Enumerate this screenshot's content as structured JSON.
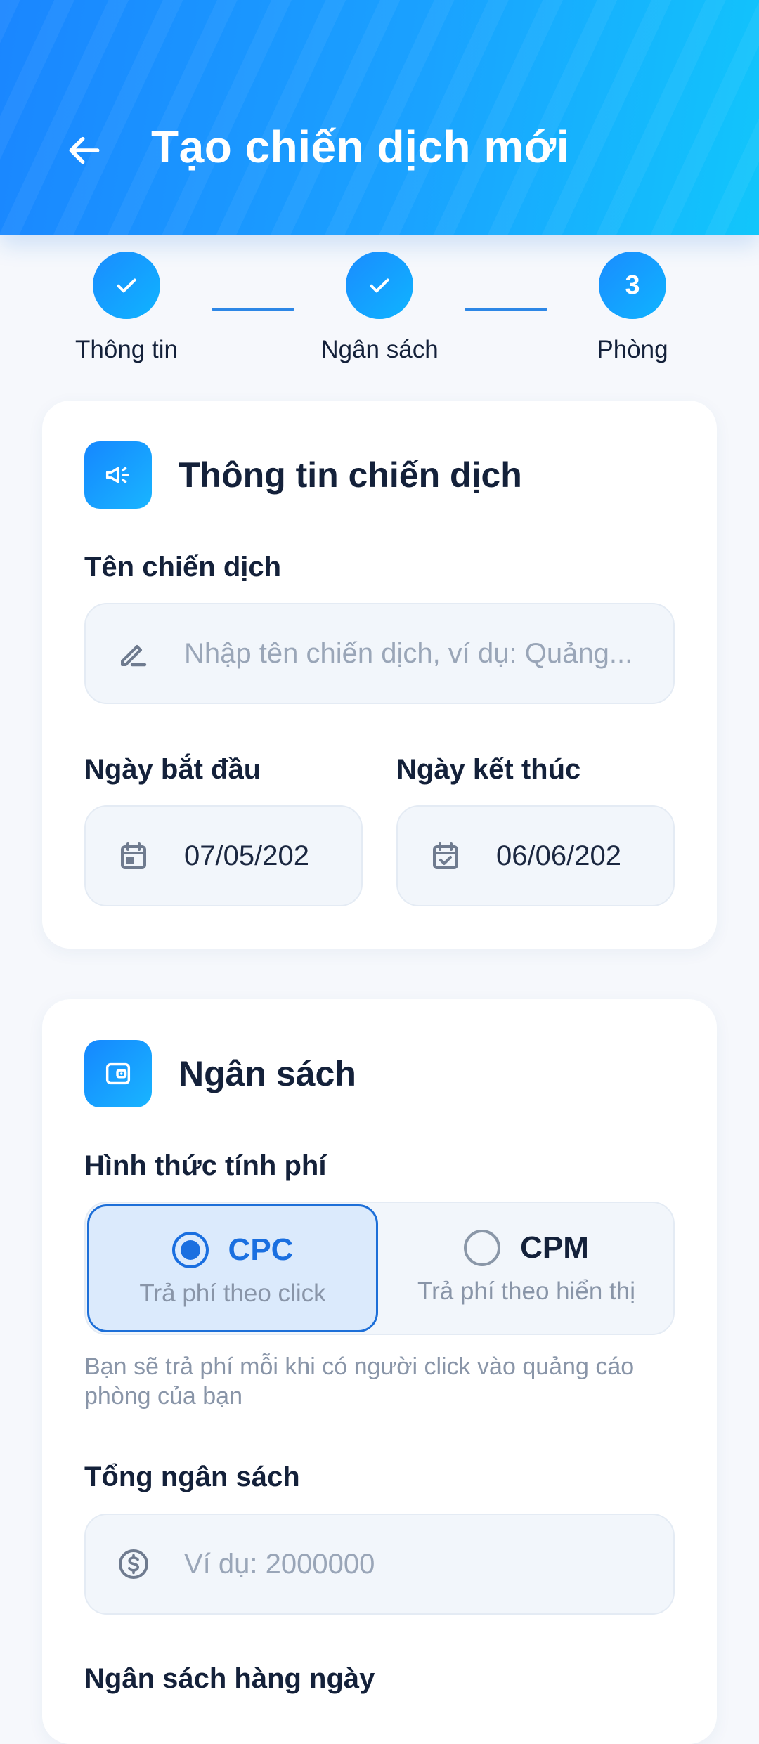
{
  "header": {
    "title": "Tạo chiến dịch mới"
  },
  "stepper": {
    "steps": [
      {
        "label": "Thông tin",
        "state": "done"
      },
      {
        "label": "Ngân sách",
        "state": "done"
      },
      {
        "label": "Phòng",
        "state": "current",
        "number": "3"
      }
    ]
  },
  "campaign_card": {
    "title": "Thông tin chiến dịch",
    "name_label": "Tên chiến dịch",
    "name_placeholder": "Nhập tên chiến dịch, ví dụ: Quảng...",
    "start_label": "Ngày bắt đầu",
    "start_value": "07/05/202",
    "end_label": "Ngày kết thúc",
    "end_value": "06/06/202"
  },
  "budget_card": {
    "title": "Ngân sách",
    "billing_label": "Hình thức tính phí",
    "options": [
      {
        "name": "CPC",
        "sub": "Trả phí theo click",
        "selected": true
      },
      {
        "name": "CPM",
        "sub": "Trả phí theo hiển thị",
        "selected": false
      }
    ],
    "help_text": "Bạn sẽ trả phí mỗi khi có người click vào quảng cáo phòng của bạn",
    "total_label": "Tổng ngân sách",
    "total_placeholder": "Ví dụ: 2000000",
    "daily_label": "Ngân sách hàng ngày"
  },
  "colors": {
    "accent": "#1a6fe0",
    "header_start": "#1a86ff",
    "header_end": "#11c6fb"
  }
}
